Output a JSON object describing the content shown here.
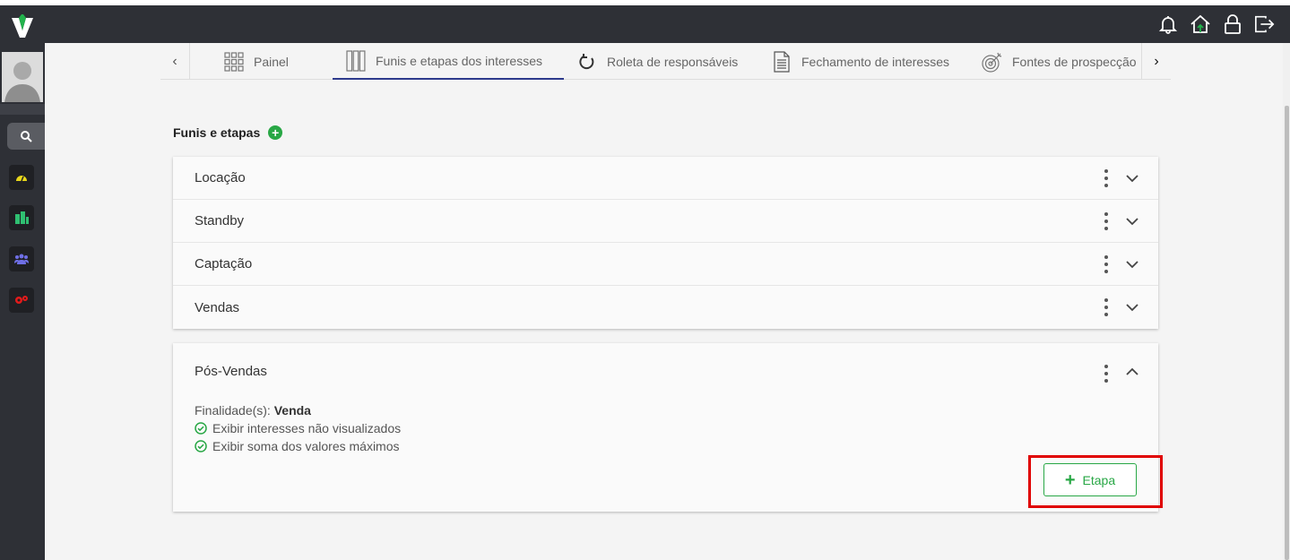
{
  "colors": {
    "accent": "#28a745",
    "tab_active": "#2d3a8c",
    "highlight": "#e00000",
    "bar": "#2e3036"
  },
  "topbar": {
    "icons": [
      "bell-icon",
      "home-icon",
      "lock-icon",
      "logout-icon"
    ]
  },
  "sidebar": {
    "items": [
      "search-icon",
      "dashboard-icon",
      "buildings-icon",
      "users-icon",
      "settings-icon"
    ]
  },
  "tabs": [
    {
      "label": "Painel",
      "icon": "grid-icon"
    },
    {
      "label": "Funis e etapas dos interesses",
      "icon": "columns-icon",
      "active": true
    },
    {
      "label": "Roleta de responsáveis",
      "icon": "refresh-icon"
    },
    {
      "label": "Fechamento de interesses",
      "icon": "document-icon"
    },
    {
      "label": "Fontes de prospecção",
      "icon": "target-icon"
    }
  ],
  "section": {
    "title": "Funis e etapas"
  },
  "funnels": [
    {
      "name": "Locação"
    },
    {
      "name": "Standby"
    },
    {
      "name": "Captação"
    },
    {
      "name": "Vendas"
    }
  ],
  "expanded": {
    "name": "Pós-Vendas",
    "purpose_label": "Finalidade(s):",
    "purpose_value": "Venda",
    "options": [
      "Exibir interesses não visualizados",
      "Exibir soma dos valores máximos"
    ],
    "add_button": "Etapa"
  }
}
